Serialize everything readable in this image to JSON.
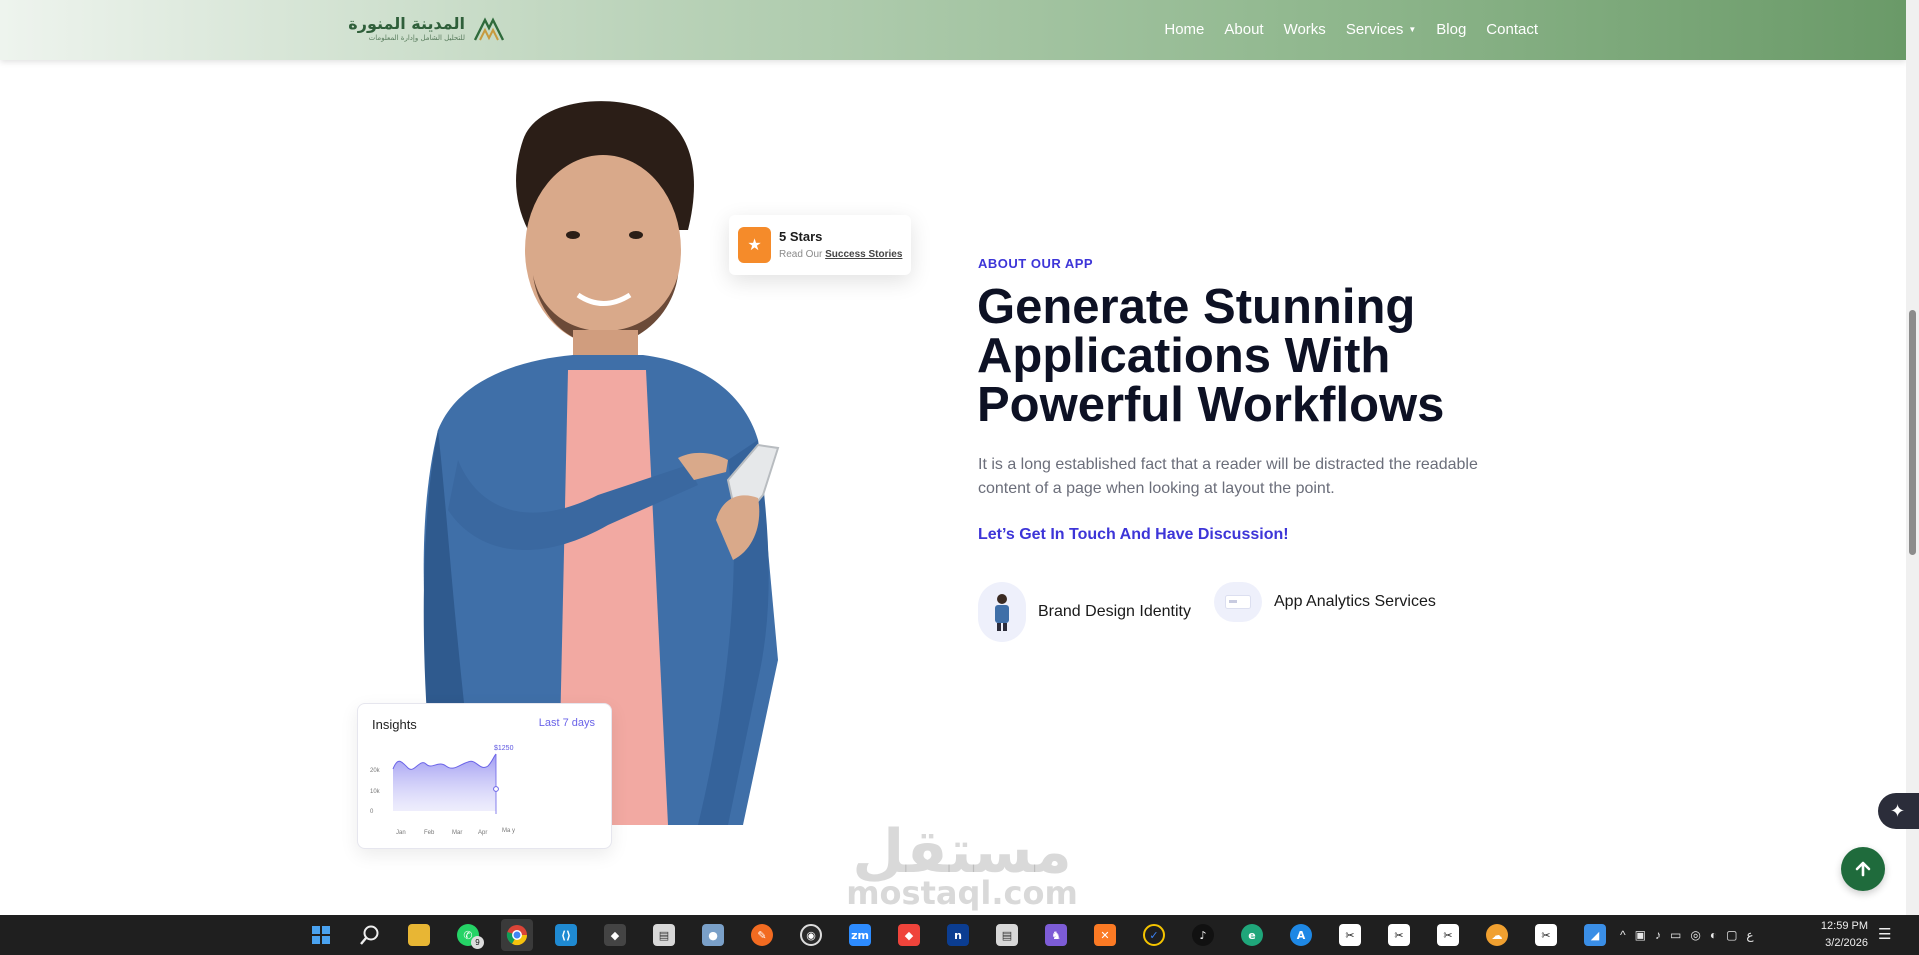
{
  "header": {
    "logo_text_ar": "المدينة المنورة",
    "logo_subtext_ar": "للتحليل الشامل وإدارة المعلومات",
    "nav": [
      {
        "label": "Home"
      },
      {
        "label": "About"
      },
      {
        "label": "Works"
      },
      {
        "label": "Services",
        "has_dropdown": true
      },
      {
        "label": "Blog"
      },
      {
        "label": "Contact"
      }
    ]
  },
  "hero": {
    "stars_card": {
      "title": "5 Stars",
      "subtitle_prefix": "Read Our",
      "link": "Success Stories"
    },
    "insights_card": {
      "title": "Insights",
      "range": "Last 7 days",
      "peak_label": "$1250",
      "y_ticks": [
        "20k",
        "10k",
        "0"
      ],
      "x_ticks": [
        "Jan",
        "Feb",
        "Mar",
        "Apr",
        "Ma y"
      ]
    }
  },
  "about": {
    "eyebrow": "ABOUT OUR APP",
    "headline_lines": [
      "Generate Stunning",
      "Applications With",
      "Powerful Workflows"
    ],
    "description": "It is a long established fact that a reader will be distracted the readable content of a page when looking at layout the point.",
    "cta": "Let’s Get In Touch And Have Discussion!",
    "features": [
      {
        "label": "Brand Design Identity",
        "icon": "person-avatar-icon"
      },
      {
        "label": "App Analytics Services",
        "icon": "analytics-card-icon"
      }
    ]
  },
  "watermark": {
    "arabic": "مستقل",
    "latin": "mostaql.com"
  },
  "floating": {
    "back_to_top_icon": "arrow-up-icon",
    "ai_icon": "sparkle-icon"
  },
  "taskbar": {
    "apps": [
      {
        "name": "start-icon"
      },
      {
        "name": "search-icon"
      },
      {
        "name": "file-explorer-icon"
      },
      {
        "name": "whatsapp-icon",
        "badge": "9"
      },
      {
        "name": "chrome-icon",
        "active": true
      },
      {
        "name": "vscode-icon"
      },
      {
        "name": "cube-app-icon"
      },
      {
        "name": "app-icon"
      },
      {
        "name": "app-icon"
      },
      {
        "name": "brush-app-icon"
      },
      {
        "name": "obs-icon"
      },
      {
        "name": "zoom-icon",
        "text": "zm"
      },
      {
        "name": "anydesk-icon"
      },
      {
        "name": "notion-icon",
        "text": "n"
      },
      {
        "name": "app-icon"
      },
      {
        "name": "app-icon"
      },
      {
        "name": "xampp-icon"
      },
      {
        "name": "check-app-icon"
      },
      {
        "name": "tiktok-icon"
      },
      {
        "name": "edge-icon"
      },
      {
        "name": "app-store-icon"
      },
      {
        "name": "capcut-icon"
      },
      {
        "name": "capcut-icon"
      },
      {
        "name": "capcut-icon"
      },
      {
        "name": "app-icon"
      },
      {
        "name": "capcut-icon"
      },
      {
        "name": "app-icon"
      }
    ],
    "tray_lang": "ع",
    "time": "12:59 PM",
    "date": "3/2/2026"
  },
  "colors": {
    "accent": "#3d35d8",
    "heading": "#0d1124",
    "brand_green": "#1f6b3c",
    "star_orange": "#f58b2a"
  }
}
